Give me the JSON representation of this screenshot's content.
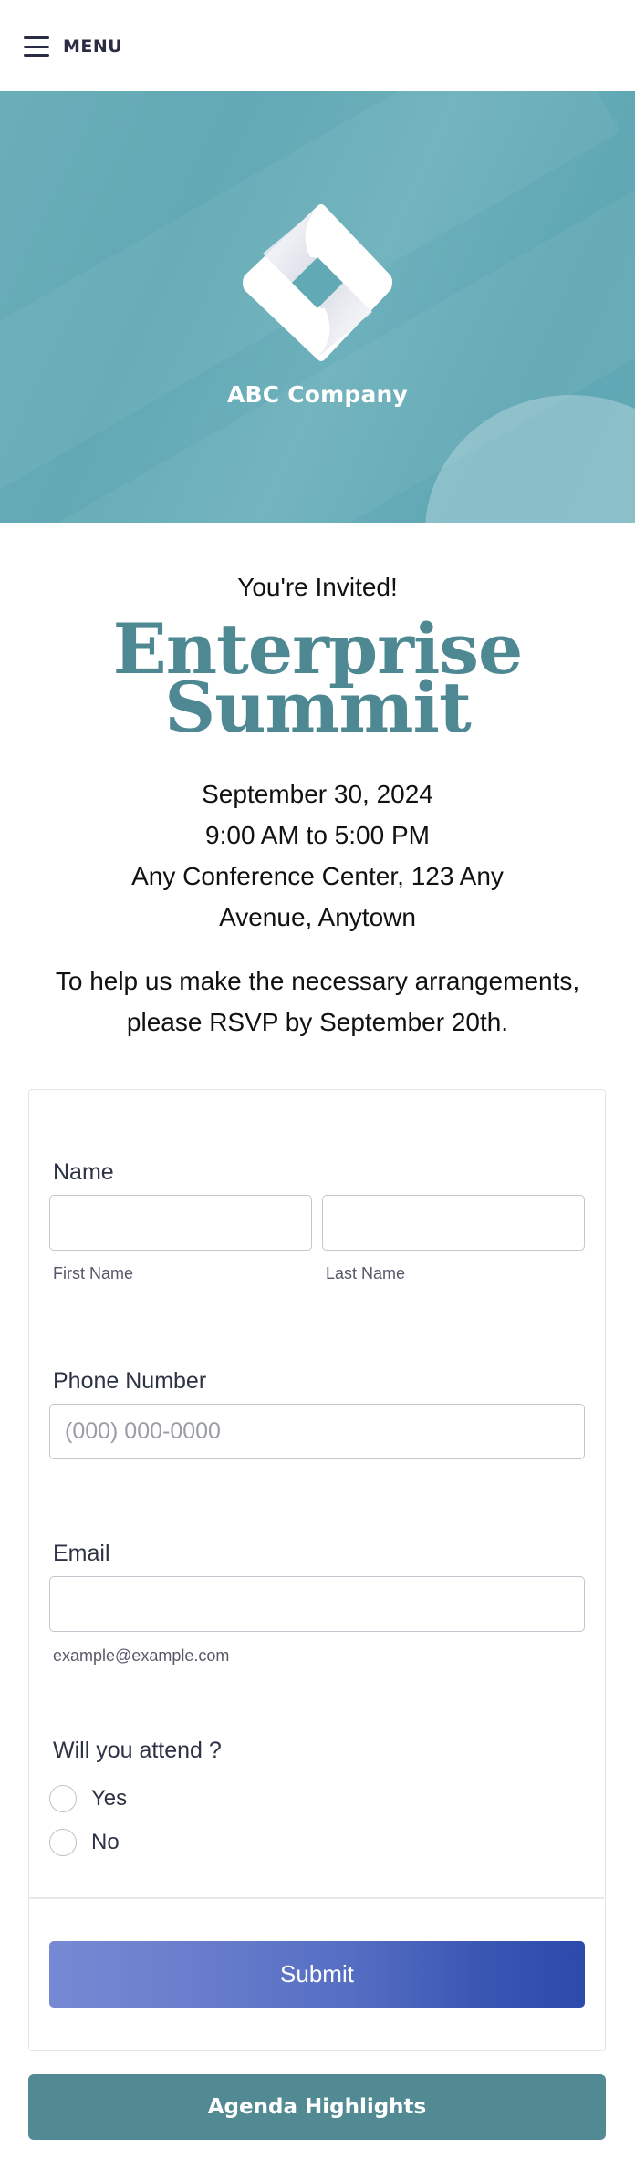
{
  "header": {
    "menu_label": "MENU",
    "menu_icon": "hamburger-menu-icon"
  },
  "banner": {
    "logo_icon": "diamond-logo-icon",
    "company_name": "ABC Company",
    "background_color": "#64aab6"
  },
  "intro": {
    "invited": "You're Invited!",
    "title_line1": "Enterprise",
    "title_line2": "Summit",
    "title_color": "#4e8993",
    "date": "September 30, 2024",
    "time": "9:00 AM to 5:00 PM",
    "location_line1": "Any Conference Center, 123 Any",
    "location_line2": "Avenue, Anytown",
    "rsvp_line1": "To help us make the necessary arrangements,",
    "rsvp_line2": "please RSVP by September 20th."
  },
  "form": {
    "name": {
      "label": "Name",
      "first": {
        "value": "",
        "sublabel": "First Name"
      },
      "last": {
        "value": "",
        "sublabel": "Last Name"
      }
    },
    "phone": {
      "label": "Phone Number",
      "value": "",
      "placeholder": "(000) 000-0000"
    },
    "email": {
      "label": "Email",
      "value": "",
      "sublabel": "example@example.com"
    },
    "attend": {
      "label": "Will you attend ?",
      "options": [
        {
          "label": "Yes",
          "selected": false
        },
        {
          "label": "No",
          "selected": false
        }
      ]
    },
    "submit_label": "Submit",
    "submit_gradient": [
      "#7689d4",
      "#2b4aab"
    ]
  },
  "agenda": {
    "label": "Agenda Highlights",
    "color": "#528a93"
  }
}
